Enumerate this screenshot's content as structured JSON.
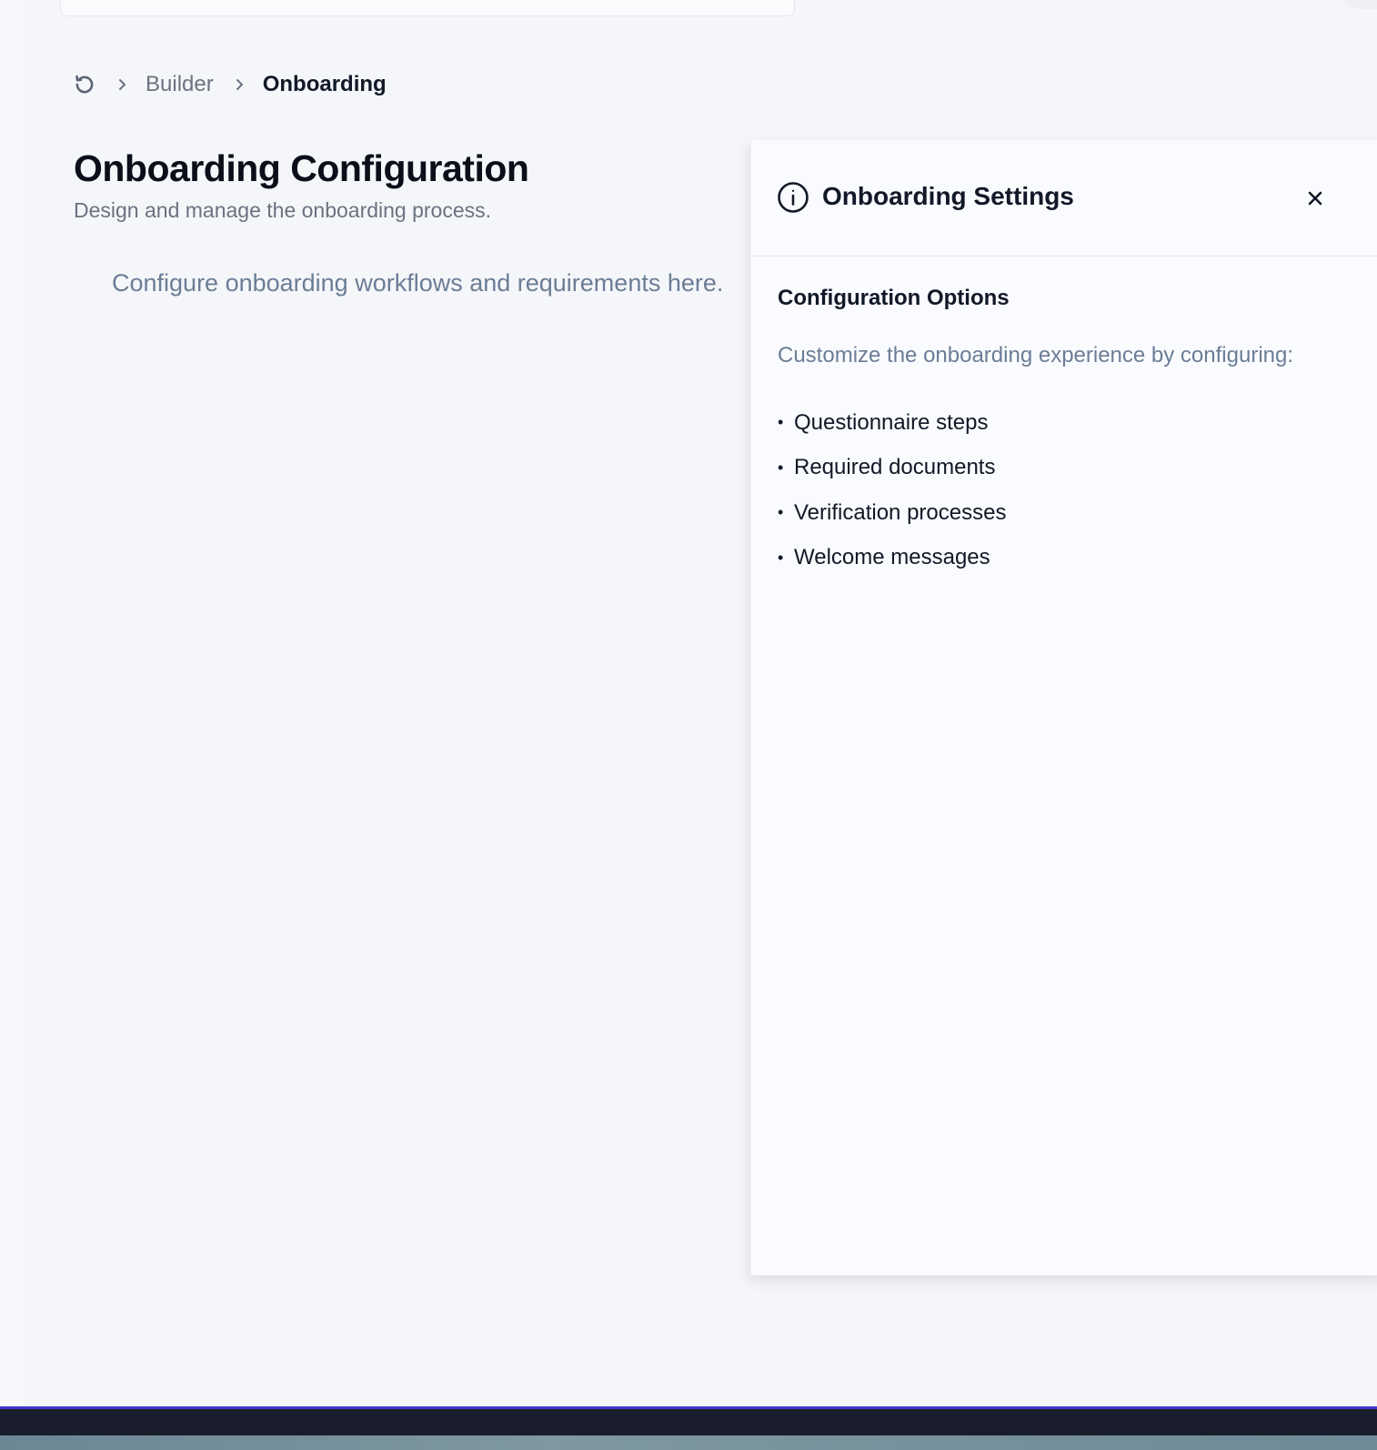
{
  "breadcrumb": {
    "home_icon": "refresh-icon",
    "items": [
      "Builder",
      "Onboarding"
    ]
  },
  "page": {
    "title": "Onboarding Configuration",
    "subtitle": "Design and manage the onboarding process.",
    "intro": "Configure onboarding workflows and requirements here."
  },
  "panel": {
    "icon": "info-circle-icon",
    "title": "Onboarding Settings",
    "close_icon": "close-icon",
    "section_title": "Configuration Options",
    "section_desc": "Customize the onboarding experience by configuring:",
    "options": [
      "Questionnaire steps",
      "Required documents",
      "Verification processes",
      "Welcome messages"
    ]
  },
  "colors": {
    "background": "#f5f6f9",
    "panel_background": "#fafbfe",
    "muted_text": "#6b7d96",
    "accent_bar": "#4338ca",
    "bottom_bar": "#1a1d2c"
  }
}
